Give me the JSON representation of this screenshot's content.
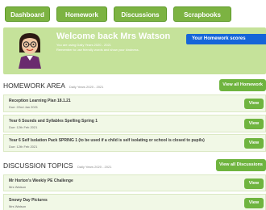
{
  "tabs": [
    "Dashboard",
    "Homework",
    "Discussions",
    "Scrapbooks"
  ],
  "welcome": {
    "title": "Welcome back Mrs Watson",
    "subtitle": "You are using Daily Years 2020 - 2021",
    "note": "Remember to use friendly words and show your kindness.",
    "scores_button": "Your Homework scores"
  },
  "homework": {
    "title": "HOMEWORK AREA",
    "year": "Daily Years 2020 - 2021",
    "view_all": "View all Homework",
    "items": [
      {
        "title": "Reception Learning Plan 18.1.21",
        "due": "Due: 22nd Jan 2021",
        "action": "View"
      },
      {
        "title": "Year 6 Sounds and Syllables Spelling Spring 1",
        "due": "Due: 12th Feb 2021",
        "action": "View"
      },
      {
        "title": "Year 6 Self Isolation Pack SPRING 1 (to be used if a child is self isolating or school is closed to pupils)",
        "due": "Due: 12th Feb 2021",
        "action": "View"
      }
    ]
  },
  "discussions": {
    "title": "DISCUSSION TOPICS",
    "year": "Daily Years 2020 - 2021",
    "view_all": "View all Discussions",
    "items": [
      {
        "title": "Mr Horton's Weekly PE Challenge",
        "author": "Mrs Watson",
        "action": "View"
      },
      {
        "title": "Snowy Day Pictures",
        "author": "Mrs Watson",
        "action": "View"
      }
    ]
  },
  "colors": {
    "tab_green": "#7cb342",
    "button_green": "#6fb43f",
    "panel_green": "#c5e29a",
    "accent_blue": "#1565d8"
  }
}
